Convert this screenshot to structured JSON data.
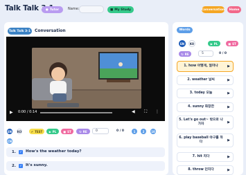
{
  "header": {
    "title": "Talk Talk 3-1",
    "tutor_label": "Tutor",
    "name_label": "Name:",
    "name_value": "",
    "study_label": "My Study",
    "conversation_label": "Conversation",
    "home_label": "Home"
  },
  "lesson": {
    "tag": "Talk Talk 3-1",
    "heading": "Conversation"
  },
  "video": {
    "time": "0:00 / 0:14",
    "progress": 0
  },
  "toolbar": {
    "en": "EN",
    "ko": "KO",
    "test": "TEST",
    "pl": "PL",
    "st": "ST",
    "re": "RE",
    "input_value": "0",
    "score": "0 / 0",
    "c1": "1",
    "c2": "2",
    "c3": "10",
    "cn": "CN"
  },
  "sentences": [
    {
      "num": "1.",
      "text": "How's the weather today?"
    },
    {
      "num": "2.",
      "text": "It's sunny."
    }
  ],
  "words_panel": {
    "tag": "Words",
    "en": "EN",
    "ko": "KO",
    "pl": "PL",
    "st": "ST",
    "re": "RE",
    "input_value": "5",
    "score": "0 / 0"
  },
  "words": [
    {
      "text": "1. how 어떻게, 얼마나",
      "active": true
    },
    {
      "text": "2. weather 날씨"
    },
    {
      "text": "3. today 오늘"
    },
    {
      "text": "4. sunny 화창한"
    },
    {
      "text": "5. Let's go out~ 밖으로 나가자"
    },
    {
      "text": "6. play baseball 야구를 하다"
    },
    {
      "text": "7. hit 치다"
    },
    {
      "text": "8. throw 던지다"
    }
  ],
  "colors": {
    "accent_blue": "#3b82c4",
    "active_word_bg": "#fff4d6",
    "active_word_border": "#f5a623"
  }
}
